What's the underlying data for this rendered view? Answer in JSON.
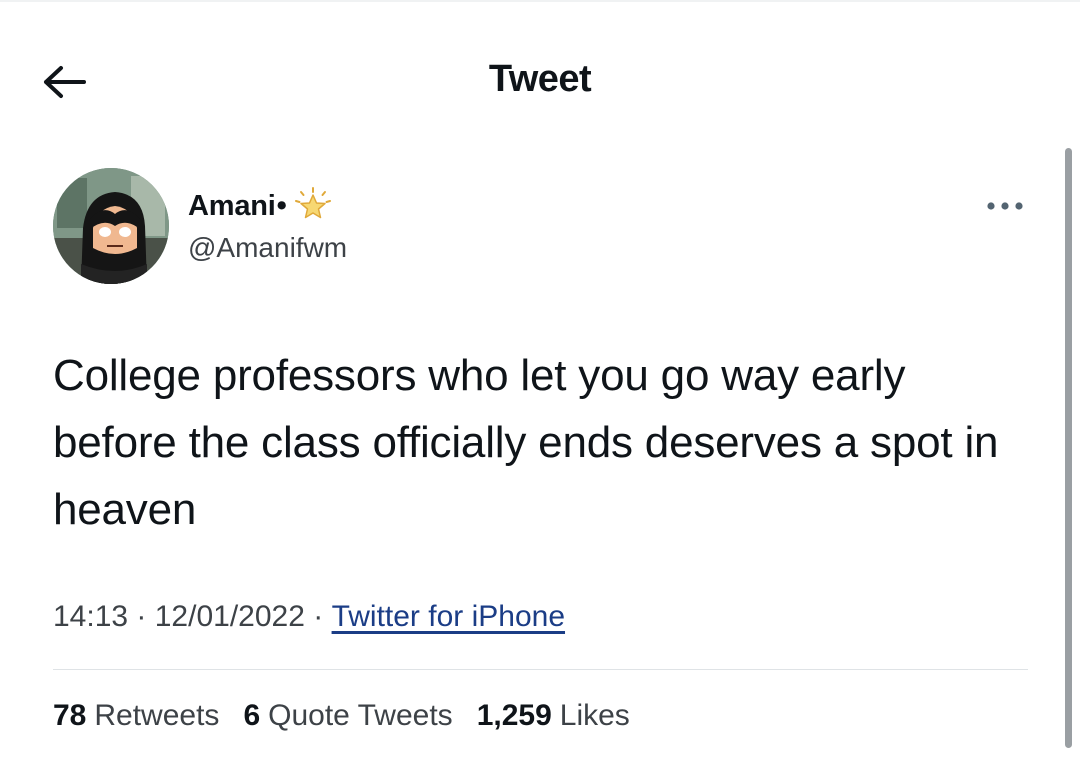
{
  "header": {
    "title": "Tweet",
    "back_icon": "arrow-left-icon"
  },
  "author": {
    "display_name": "Amani",
    "name_suffix": "•",
    "badge_icon": "sparkle-star-icon",
    "handle": "@Amanifwm",
    "avatar_icon": "avatar-image"
  },
  "tweet": {
    "text": "College professors who let you go way early before the class officially ends deserves a spot in heaven"
  },
  "meta": {
    "time": "14:13",
    "separator": " · ",
    "date": "12/01/2022",
    "source": "Twitter for iPhone"
  },
  "stats": {
    "retweets_count": "78",
    "retweets_label": "Retweets",
    "quotes_count": "6",
    "quotes_label": "Quote Tweets",
    "likes_count": "1,259",
    "likes_label": "Likes"
  },
  "colors": {
    "text": "#0f1419",
    "secondary_text": "#3d4247",
    "link": "#1b3d86",
    "divider": "#dfe3e6",
    "star_fill": "#f7d873"
  }
}
